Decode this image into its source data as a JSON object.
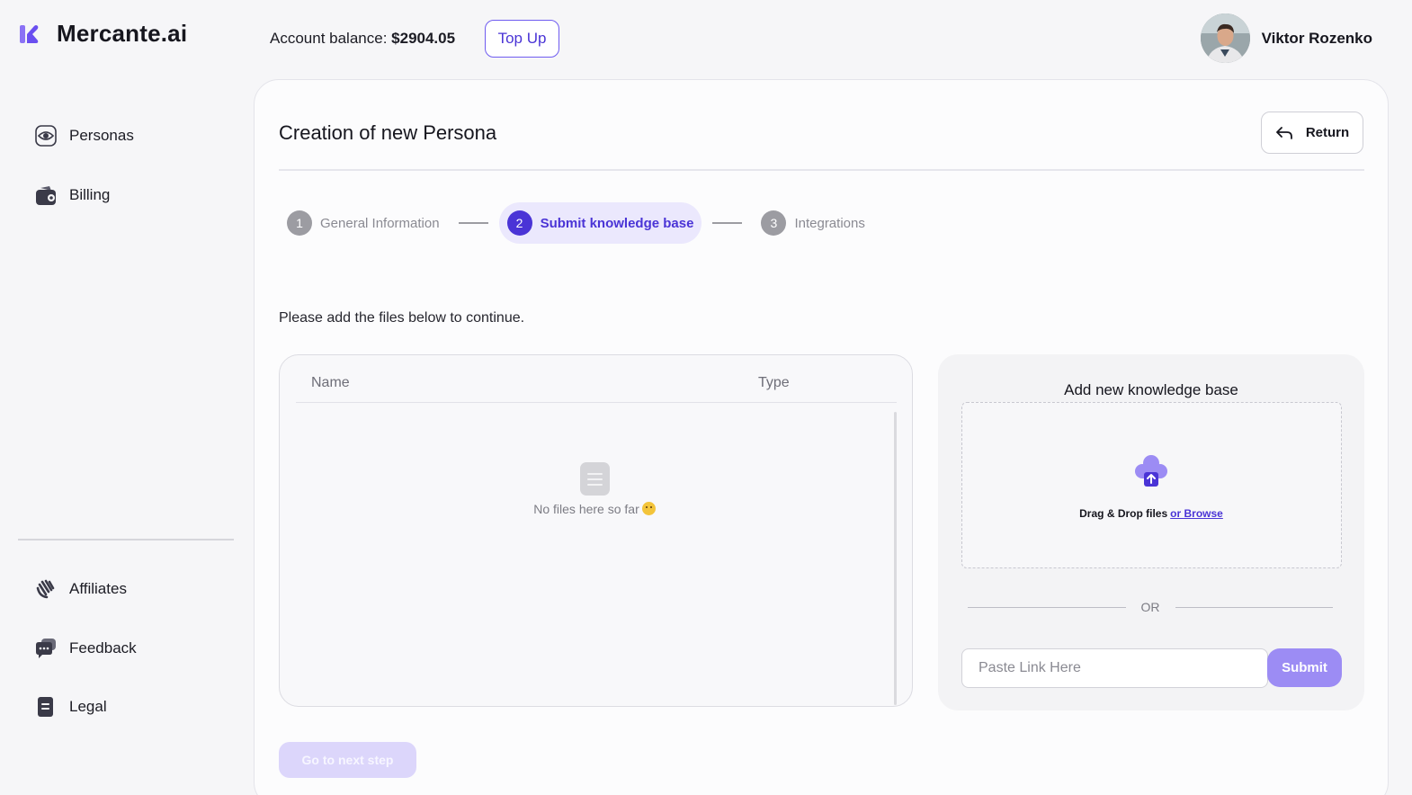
{
  "app": {
    "brand": "Mercante.ai"
  },
  "header": {
    "balance_label": "Account balance:",
    "balance_value": "$2904.05",
    "topup_label": "Top Up",
    "user_name": "Viktor Rozenko"
  },
  "sidebar": {
    "top_items": [
      {
        "label": "Personas",
        "icon": "eye-icon"
      },
      {
        "label": "Billing",
        "icon": "wallet-icon"
      }
    ],
    "bottom_items": [
      {
        "label": "Affiliates",
        "icon": "waving-hand-icon"
      },
      {
        "label": "Feedback",
        "icon": "chat-bubble-icon"
      },
      {
        "label": "Legal",
        "icon": "document-icon"
      }
    ]
  },
  "page": {
    "title": "Creation of new Persona",
    "return_label": "Return",
    "steps": [
      {
        "num": "1",
        "label": "General Information",
        "state": "inactive"
      },
      {
        "num": "2",
        "label": "Submit knowledge base",
        "state": "active"
      },
      {
        "num": "3",
        "label": "Integrations",
        "state": "inactive"
      }
    ],
    "instructions": "Please add the files below to continue.",
    "files": {
      "columns": [
        "Name",
        "Type"
      ],
      "empty_text": "No files here so far"
    },
    "upload": {
      "title": "Add new knowledge base",
      "drop_text": "Drag & Drop files",
      "browse_label": "or Browse",
      "or_label": "OR",
      "link_placeholder": "Paste Link Here",
      "submit_label": "Submit"
    },
    "next_label": "Go to next step"
  },
  "colors": {
    "accent": "#4a34d6",
    "accent_light": "#9c8cf4",
    "step_active_bg": "#ebe8fd"
  }
}
